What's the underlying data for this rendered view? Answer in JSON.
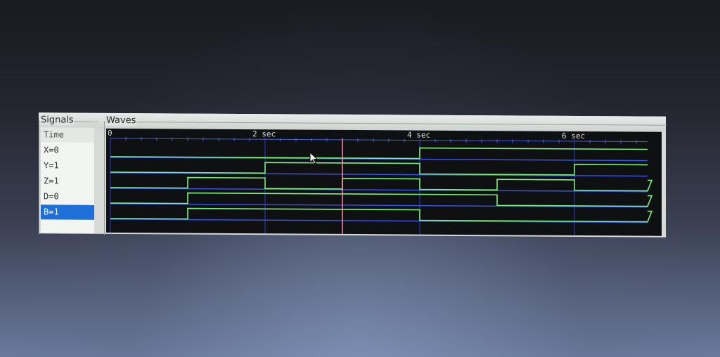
{
  "panels": {
    "signals_title": "Signals",
    "waves_title": "Waves"
  },
  "signals": [
    {
      "label": "Time",
      "role": "header",
      "selected": false
    },
    {
      "label": "X=0",
      "selected": false
    },
    {
      "label": "Y=1",
      "selected": false
    },
    {
      "label": "Z=1",
      "selected": false
    },
    {
      "label": "D=0",
      "selected": false
    },
    {
      "label": "B=1",
      "selected": true
    }
  ],
  "colors": {
    "wave_high": "#7cf07c",
    "wave_low": "#3a52e0",
    "cursor": "#ff8fb0",
    "selected": "#1f6fd8",
    "tick": "#4a5cd8"
  },
  "chart_data": {
    "type": "line",
    "x_unit": "sec",
    "x_range": [
      0,
      7
    ],
    "major_ticks": [
      {
        "t": 0,
        "label": "0"
      },
      {
        "t": 2,
        "label": "2 sec"
      },
      {
        "t": 4,
        "label": "4 sec"
      },
      {
        "t": 6,
        "label": "6 sec"
      }
    ],
    "cursor_time": 3.0,
    "series": [
      {
        "name": "X",
        "segments": [
          [
            0,
            0
          ],
          [
            4,
            1
          ]
        ]
      },
      {
        "name": "Y",
        "segments": [
          [
            0,
            0
          ],
          [
            2,
            1
          ],
          [
            4,
            0
          ],
          [
            6,
            1
          ]
        ]
      },
      {
        "name": "Z",
        "segments": [
          [
            0,
            0
          ],
          [
            1,
            1
          ],
          [
            2,
            0
          ],
          [
            3,
            1
          ],
          [
            4,
            0
          ],
          [
            5,
            1
          ],
          [
            6,
            0
          ],
          [
            7,
            1
          ]
        ]
      },
      {
        "name": "D",
        "segments": [
          [
            0,
            0
          ],
          [
            1,
            1
          ],
          [
            4,
            1
          ],
          [
            5,
            0
          ],
          [
            7,
            1
          ]
        ]
      },
      {
        "name": "B",
        "segments": [
          [
            0,
            0
          ],
          [
            1,
            1
          ],
          [
            4,
            0
          ],
          [
            7,
            1
          ]
        ]
      }
    ]
  }
}
